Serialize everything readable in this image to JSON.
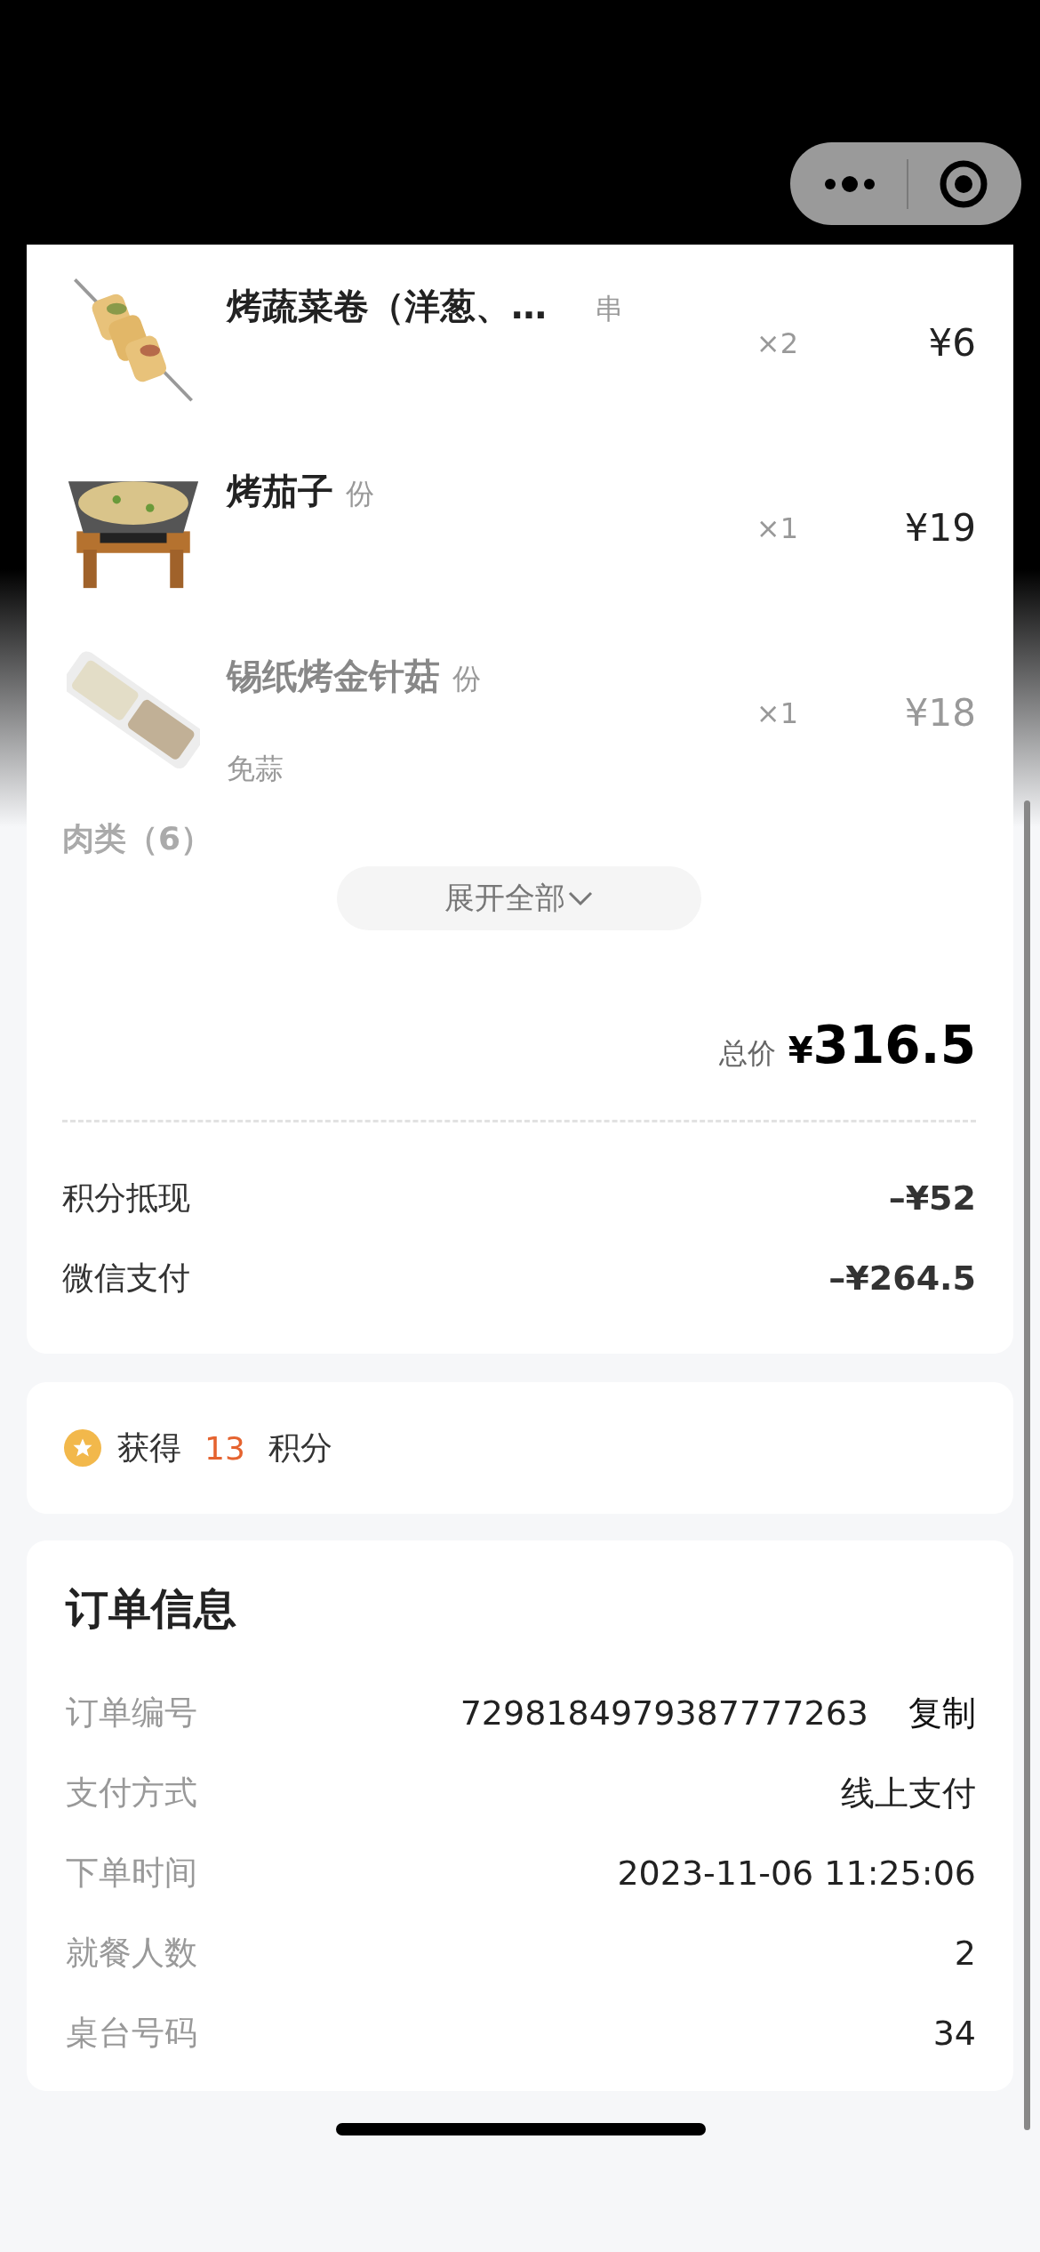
{
  "items": [
    {
      "name": "烤蔬菜卷（洋葱、…",
      "unit": "串",
      "quantity": "×2",
      "price": "¥6"
    },
    {
      "name": "烤茄子",
      "unit": "份",
      "quantity": "×1",
      "price": "¥19"
    },
    {
      "name": "锡纸烤金针菇",
      "unit": "份",
      "quantity": "×1",
      "price": "¥18",
      "note": "免蒜"
    }
  ],
  "next_category": "肉类（6）",
  "expand_button": "展开全部",
  "total": {
    "label": "总价",
    "currency": "¥",
    "amount": "316.5"
  },
  "payments": [
    {
      "label": "积分抵现",
      "amount": "–¥52"
    },
    {
      "label": "微信支付",
      "amount": "–¥264.5"
    }
  ],
  "points": {
    "prefix": "获得",
    "value": "13",
    "suffix": "积分"
  },
  "order_info": {
    "title": "订单信息",
    "rows": [
      {
        "label": "订单编号",
        "value": "7298184979387777263",
        "action": "复制"
      },
      {
        "label": "支付方式",
        "value": "线上支付"
      },
      {
        "label": "下单时间",
        "value": "2023-11-06 11:25:06"
      },
      {
        "label": "就餐人数",
        "value": "2"
      },
      {
        "label": "桌台号码",
        "value": "34"
      }
    ]
  }
}
